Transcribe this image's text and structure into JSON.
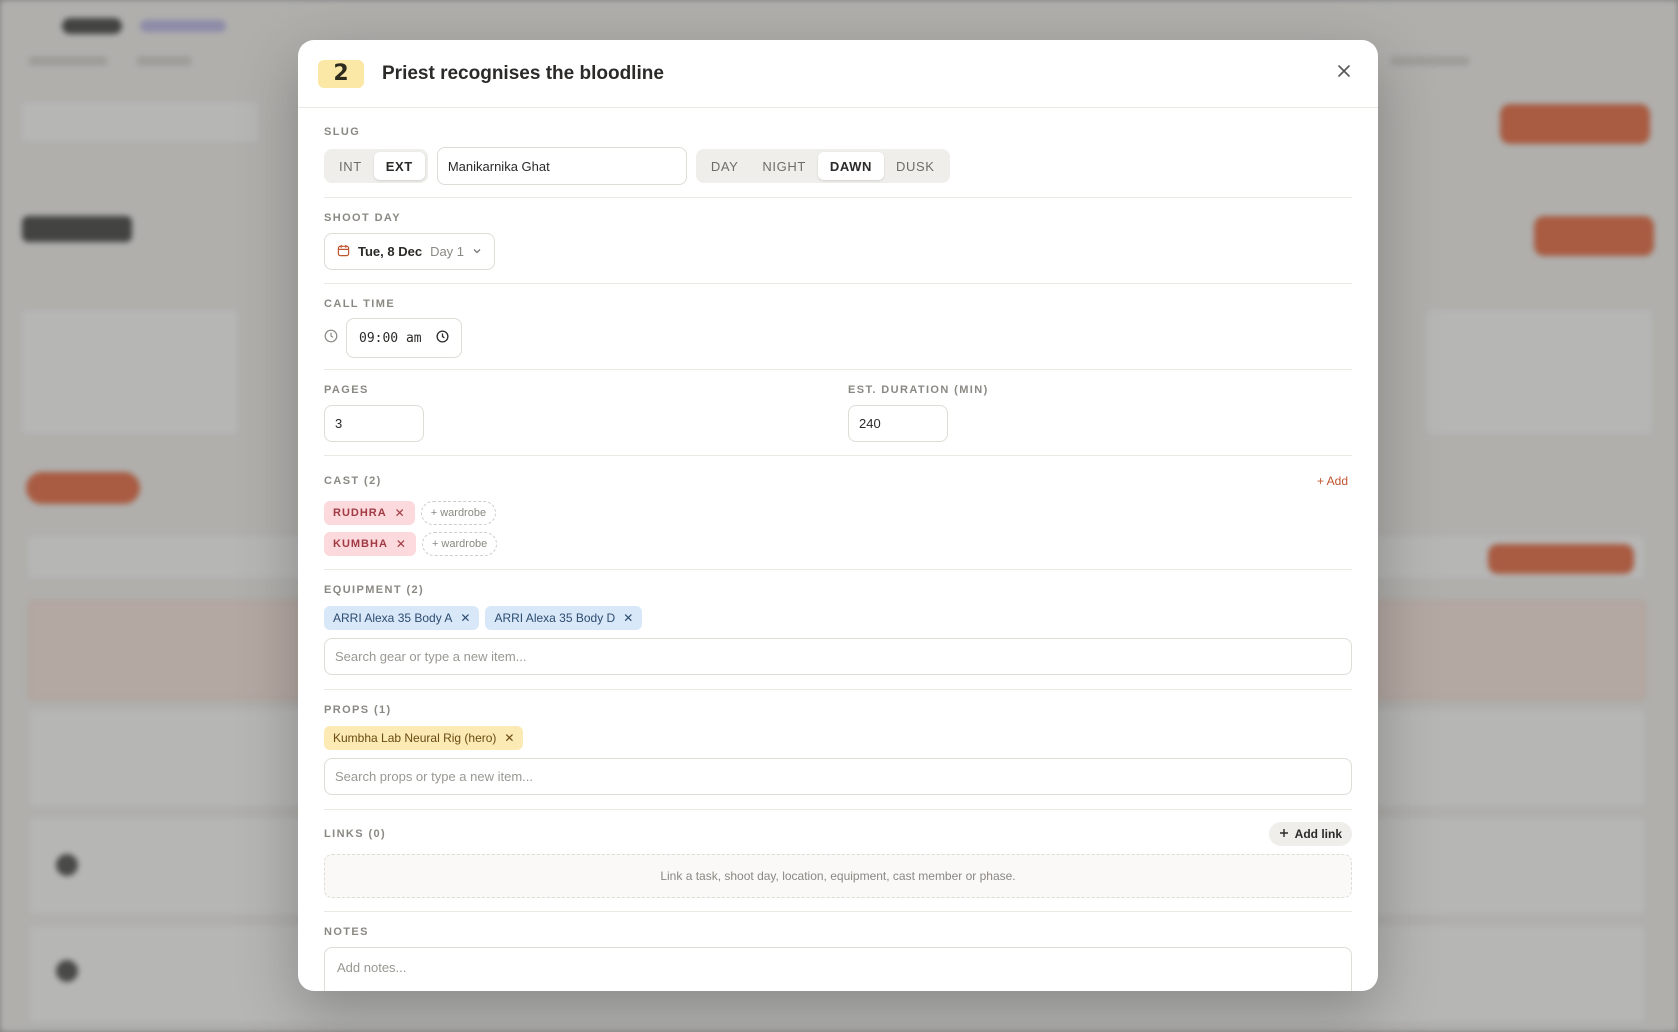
{
  "scene": {
    "number": "2",
    "title": "Priest recognises the bloodline"
  },
  "slug": {
    "label": "SLUG",
    "int_ext_options": [
      "INT",
      "EXT"
    ],
    "int_ext_selected": "EXT",
    "location_value": "Manikarnika Ghat",
    "time_of_day_options": [
      "DAY",
      "NIGHT",
      "DAWN",
      "DUSK"
    ],
    "time_of_day_selected": "DAWN"
  },
  "shoot_day": {
    "label": "SHOOT DAY",
    "date": "Tue, 8 Dec",
    "day": "Day 1"
  },
  "call_time": {
    "label": "CALL TIME",
    "value": "09:00 am"
  },
  "pages": {
    "label": "PAGES",
    "value": "3"
  },
  "duration": {
    "label": "EST. DURATION (MIN)",
    "value": "240"
  },
  "cast": {
    "label": "CAST (2)",
    "add_label": "+ Add",
    "members": [
      {
        "name": "RUDHRA",
        "wardrobe": "+ wardrobe"
      },
      {
        "name": "KUMBHA",
        "wardrobe": "+ wardrobe"
      }
    ]
  },
  "equipment": {
    "label": "EQUIPMENT (2)",
    "items": [
      "ARRI Alexa 35 Body A",
      "ARRI Alexa 35 Body D"
    ],
    "search_placeholder": "Search gear or type a new item..."
  },
  "props": {
    "label": "PROPS (1)",
    "items": [
      "Kumbha Lab Neural Rig (hero)"
    ],
    "search_placeholder": "Search props or type a new item..."
  },
  "links": {
    "label": "LINKS (0)",
    "add_label": "Add link",
    "empty_text": "Link a task, shoot day, location, equipment, cast member or phase."
  },
  "notes": {
    "label": "NOTES",
    "placeholder": "Add notes..."
  },
  "colors": {
    "accent": "#e8643a",
    "badge": "#fbe8a6",
    "cast_chip": "#fbd9dc",
    "equipment_chip": "#d9e8f8",
    "prop_chip": "#fbeab3"
  }
}
